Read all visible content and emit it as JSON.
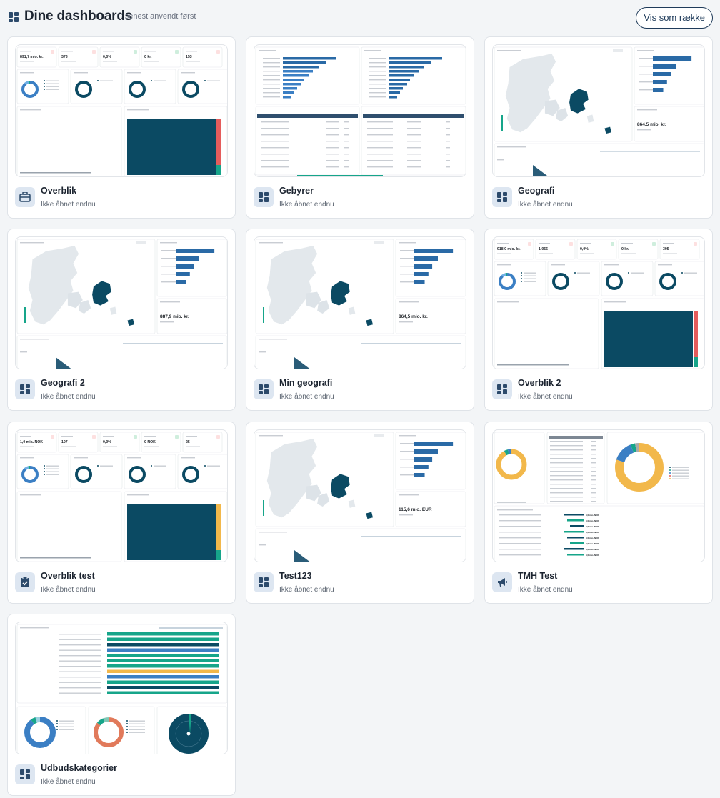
{
  "header": {
    "title": "Dine dashboards",
    "subtitle": "· senest anvendt først",
    "row_button": "Vis som række",
    "icon": "dashboard-grid-icon"
  },
  "colors": {
    "navy": "#0b4a63",
    "blue": "#3b7fc4",
    "teal": "#16a58a",
    "red": "#e55c5c",
    "yellow": "#f2b84b",
    "icon_bg": "#dde6f1",
    "icon_fg": "#2c4a6b"
  },
  "cards": [
    {
      "title": "Overblik",
      "status": "Ikke åbnet endnu",
      "icon": "toolbox-icon",
      "preview": "overview",
      "kpis": [
        "891,7 mio. kr.",
        "373",
        "0,0%",
        "0 kr.",
        "153"
      ]
    },
    {
      "title": "Gebyrer",
      "status": "Ikke åbnet endnu",
      "icon": "dashboard-icon",
      "preview": "bars"
    },
    {
      "title": "Geografi",
      "status": "Ikke åbnet endnu",
      "icon": "dashboard-icon",
      "preview": "geo",
      "kpi": "864,5 mio. kr."
    },
    {
      "title": "Geografi 2",
      "status": "Ikke åbnet endnu",
      "icon": "dashboard-icon",
      "preview": "geo",
      "kpi": "887,9 mio. kr."
    },
    {
      "title": "Min geografi",
      "status": "Ikke åbnet endnu",
      "icon": "dashboard-icon",
      "preview": "geo",
      "kpi": "864,5 mio. kr."
    },
    {
      "title": "Overblik 2",
      "status": "Ikke åbnet endnu",
      "icon": "dashboard-icon",
      "preview": "overview",
      "kpis": [
        "918,0 mio. kr.",
        "1.056",
        "0,0%",
        "0 kr.",
        "395"
      ]
    },
    {
      "title": "Overblik test",
      "status": "Ikke åbnet endnu",
      "icon": "clipboard-check-icon",
      "preview": "overview",
      "kpis": [
        "1,0 mia. NOK",
        "107",
        "0,0%",
        "0 NOK",
        "25"
      ]
    },
    {
      "title": "Test123",
      "status": "Ikke åbnet endnu",
      "icon": "dashboard-icon",
      "preview": "geo",
      "kpi": "115,6 mio. EUR"
    },
    {
      "title": "TMH Test",
      "status": "Ikke åbnet endnu",
      "icon": "megaphone-icon",
      "preview": "tmh"
    },
    {
      "title": "Udbudskategorier",
      "status": "Ikke åbnet endnu",
      "icon": "dashboard-icon",
      "preview": "categories"
    }
  ]
}
